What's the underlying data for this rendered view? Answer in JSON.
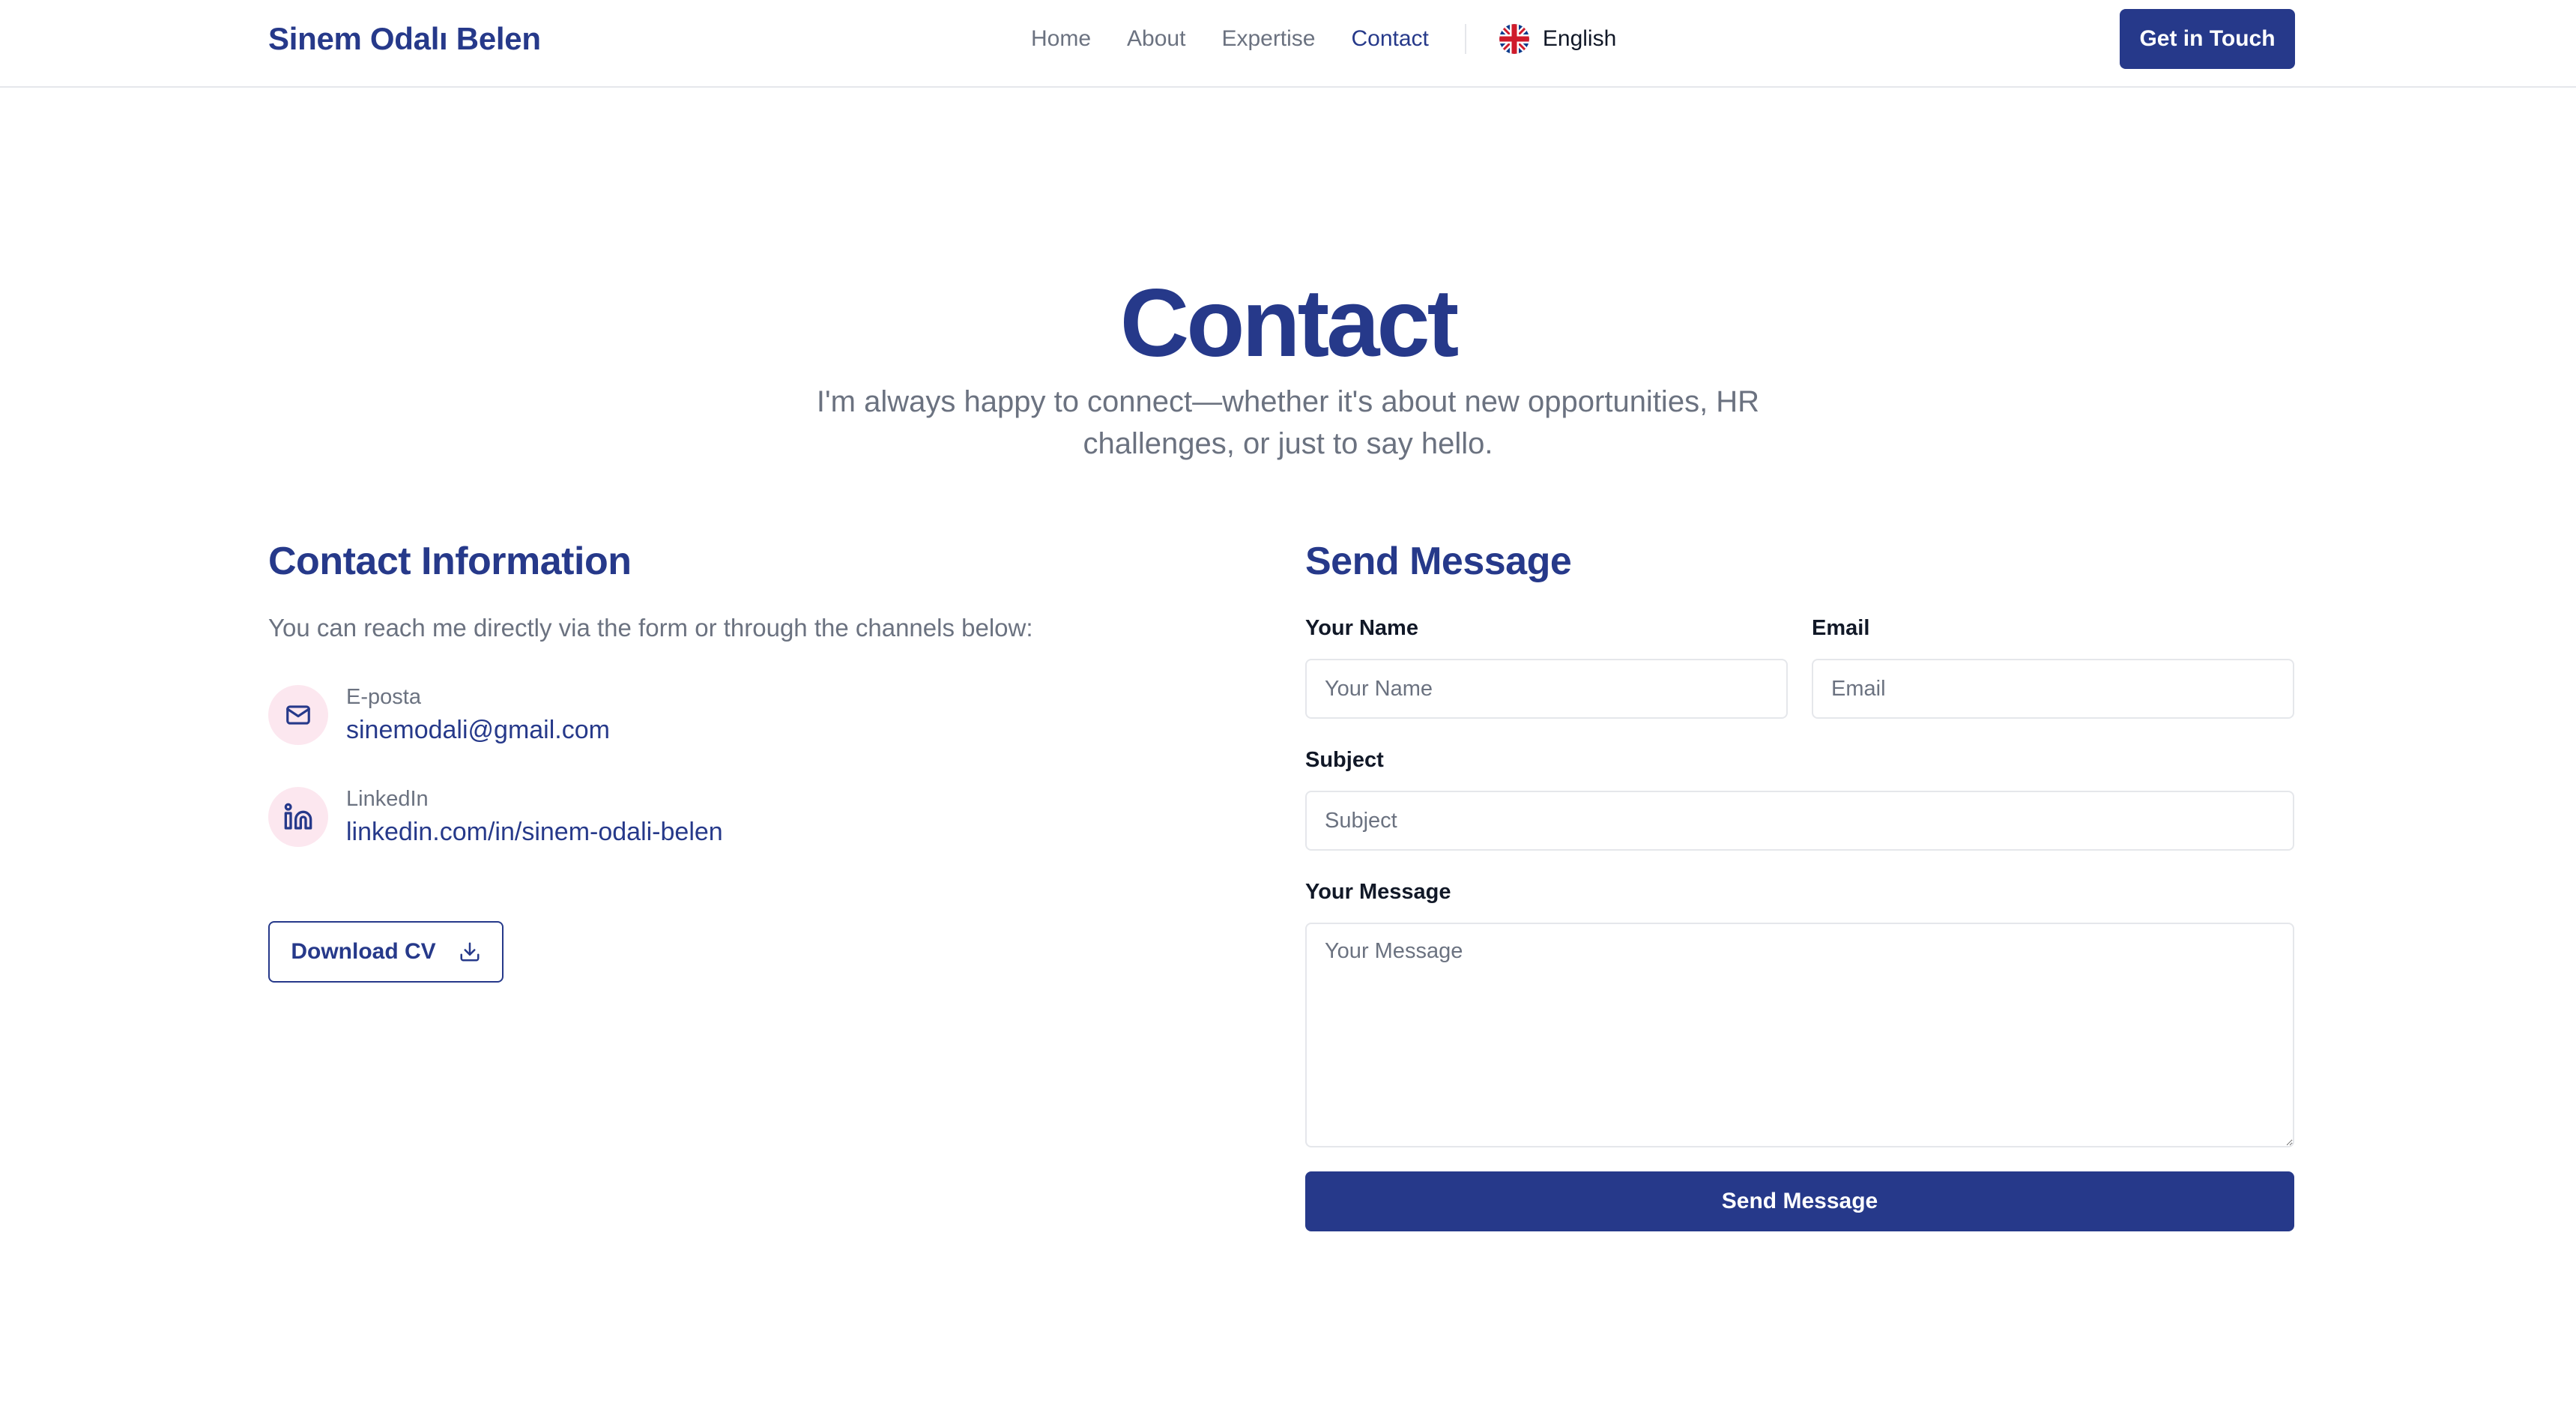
{
  "header": {
    "brand": "Sinem Odalı Belen",
    "nav": {
      "home": "Home",
      "about": "About",
      "expertise": "Expertise",
      "contact": "Contact"
    },
    "active_nav": "Contact",
    "language": {
      "label": "English",
      "icon": "uk-flag-icon"
    },
    "cta_label": "Get in Touch"
  },
  "hero": {
    "title": "Contact",
    "subtitle": "I'm always happy to connect—whether it's about new opportunities, HR challenges, or just to say hello."
  },
  "contact_info": {
    "title": "Contact Information",
    "description": "You can reach me directly via the form or through the channels below:",
    "email": {
      "label": "E-posta",
      "value": "sinemodali@gmail.com",
      "icon": "mail-icon"
    },
    "linkedin": {
      "label": "LinkedIn",
      "value": "linkedin.com/in/sinem-odali-belen",
      "icon": "linkedin-icon"
    },
    "download_label": "Download CV",
    "download_icon": "download-icon"
  },
  "form": {
    "title": "Send Message",
    "name": {
      "label": "Your Name",
      "placeholder": "Your Name",
      "value": ""
    },
    "email": {
      "label": "Email",
      "placeholder": "Email",
      "value": ""
    },
    "subject": {
      "label": "Subject",
      "placeholder": "Subject",
      "value": ""
    },
    "message": {
      "label": "Your Message",
      "placeholder": "Your Message",
      "value": ""
    },
    "submit_label": "Send Message"
  },
  "colors": {
    "primary": "#26398a",
    "muted_text": "#6b7280",
    "icon_background": "#fce7ef",
    "border": "#e5e7eb"
  }
}
